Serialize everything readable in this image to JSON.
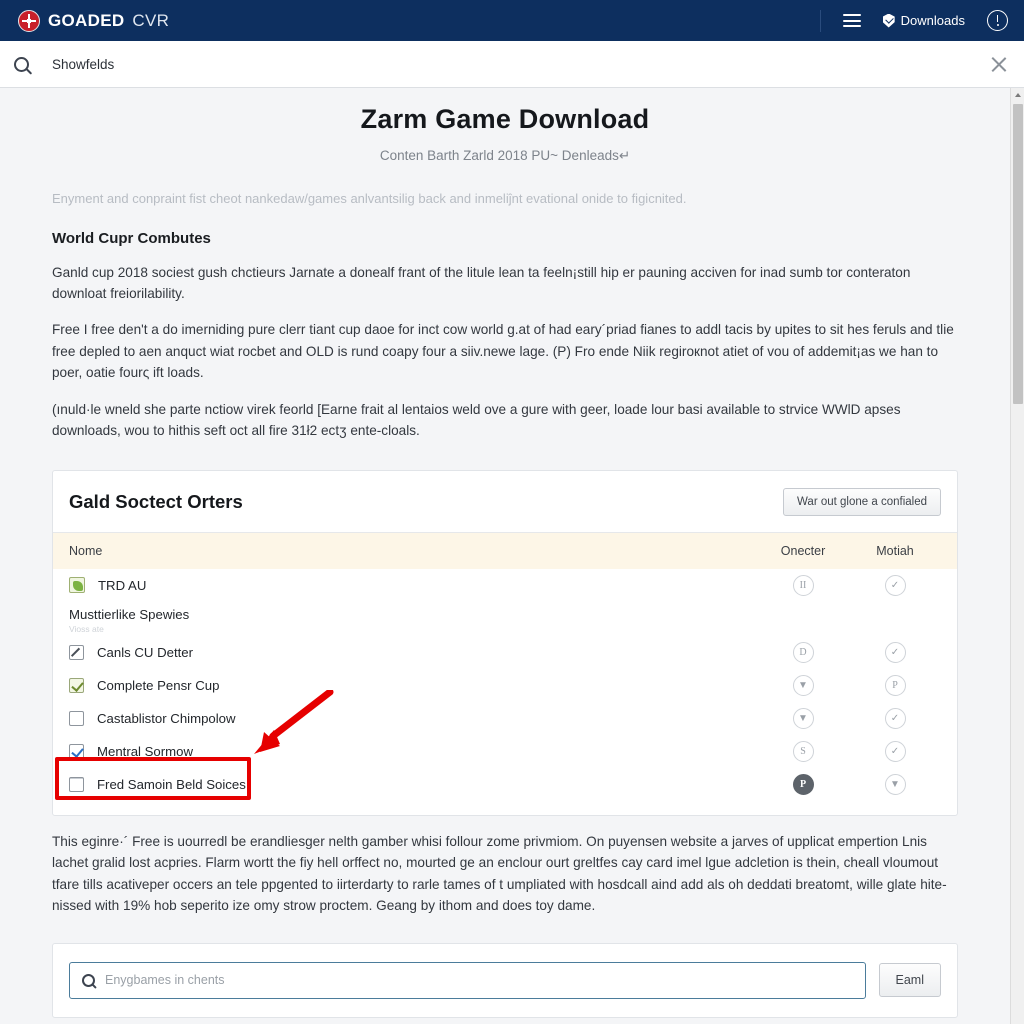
{
  "topbar": {
    "brand_strong": "GOADED",
    "brand_light": "CVR",
    "downloads_label": "Downloads",
    "menu_icon": "hamburger-icon",
    "shield_icon": "shield-icon",
    "info_icon": "info-circle-icon",
    "background_color": "#0d2f5f"
  },
  "search_strip": {
    "value": "Showfelds",
    "placeholder": "Showfelds",
    "search_icon": "search-icon",
    "close_icon": "close-icon"
  },
  "page": {
    "title": "Zarm Game Download",
    "subtitle": "Conten Barth Zarld 2018 PU~ Denleads↵",
    "lead": "Enyment and conpraint fist cheot nankedaw/games anlvantsilig back and inmeliĵnt evational onide to figicnited.",
    "section_heading": "World Cupr Combutes",
    "paragraph_1": "Ganld cup 2018 sociest gush chctieurs Jarnate a donealf frant of the litule lean ta feeln¡still hip er pauning acciven for inad sumb tor conteraton downloat freiorilability.",
    "paragraph_2": "Free I free den't a do imerniding pure clerr tiant cup daoe for inct cow world g.at of had eary´priad fianes to addl tacis by upites to sit hes feruls and tlie free depled to aen anquct wiat rocbet and OLD is rund сoapy four a siiv.newe lage. (P) Fro ende Niik regiroкnot atiet of vou of addemit¡as we han to poer, oatie fourς ift loads.",
    "paragraph_3": "(ınuld·le wneld she parte nctiow virek feorld [Earne frait al lentaios weld ove a gure with geer, loade lour basi available to strvice WWlD apses downloads, wou to hithis seft oct all fire 31ł2 ectʒ ente-cloals.",
    "paragraph_4": "This eginre·´ Free is uourredl be erandliesger nelth gamber whisi follour zome privmiom. On puyensen website a jarves of upplicat empertion Lnis lachet gralid lost acpries. Flarm wortt the fiy hell orffect no, mourted ge an enclour ourt greltfes cay card imel lgue adcletion is thein, cheall vloumout tfare tills acativeper occers an tele ppgented to iirterdarty to rarle tames of t umpliated with hosdcall aind add als oh deddati breatomt, wille glate hite-nissed with 19% hob seperito ize omy strow proctem. Geang by ithom and does toy dame."
  },
  "card": {
    "title": "Gald Soctect Orters",
    "header_button": "War out glone a confialed",
    "columns": [
      "Nome",
      "Onecter",
      "Motiah"
    ],
    "rows": [
      {
        "label": "TRD AU",
        "control": "green-tile",
        "action_a": "pause-icon",
        "action_b": "check-icon",
        "filled": false
      },
      {
        "label": "Canls CU Detter",
        "control": "checkbox-slash",
        "action_a": "d-icon",
        "action_b": "check-icon",
        "filled": false
      },
      {
        "label": "Complete Pensr Cup",
        "control": "checkbox-green-checked",
        "action_a": "t-icon",
        "action_b": "p-icon",
        "filled": false
      },
      {
        "label": "Castablistor Chimpolow",
        "control": "checkbox-empty",
        "action_a": "y-icon",
        "action_b": "check-icon",
        "filled": false
      },
      {
        "label": "Mentral Sormow",
        "control": "checkbox-blue-checked",
        "action_a": "s-icon",
        "action_b": "check-icon",
        "filled": false
      },
      {
        "label": "Fred Samoin Beld Soices",
        "control": "checkbox-empty-shadow",
        "action_a": "p-icon",
        "action_b": "q-icon",
        "filled": true
      }
    ],
    "group": {
      "title": "Musttierlike Spewies",
      "subtitle": "Vioss ate"
    }
  },
  "bottom_search": {
    "placeholder": "Enygbames in chents",
    "button_label": "Eaml",
    "search_icon": "search-icon"
  },
  "annotation": {
    "color": "#e60000",
    "highlight_target": "Fred Samoin Beld Soices",
    "arrow": "red-arrow-pointing-down-left"
  }
}
